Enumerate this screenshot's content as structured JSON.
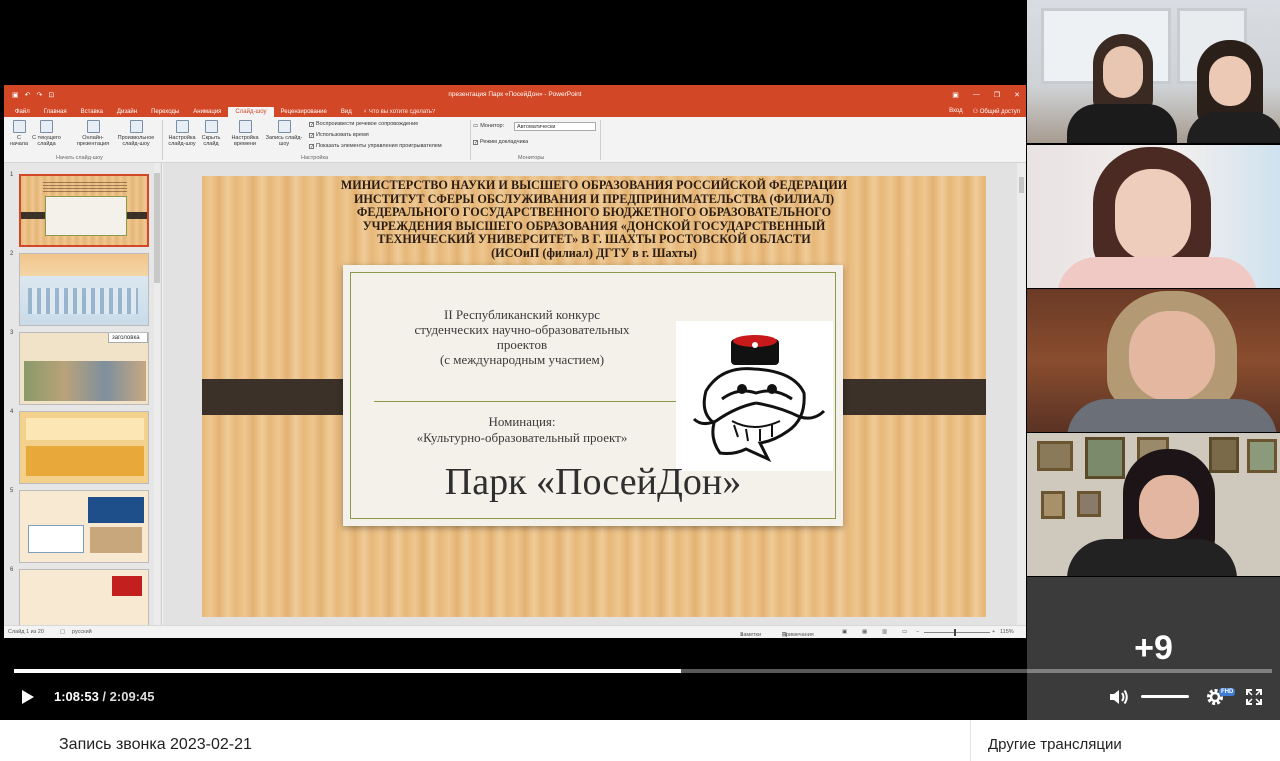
{
  "player": {
    "current_time": "1:08:53",
    "separator": " / ",
    "duration": "2:09:45",
    "progress": 0.53,
    "extra_participants": "+9",
    "quality_badge": "FHD"
  },
  "powerpoint": {
    "window_title": "презентация Парк «ПосейДон» - PowerPoint",
    "window_controls": [
      "▣",
      "—",
      "❐",
      "✕"
    ],
    "tabs": [
      "Файл",
      "Главная",
      "Вставка",
      "Дизайн",
      "Переходы",
      "Анимация",
      "Слайд-шоу",
      "Рецензирование",
      "Вид"
    ],
    "active_tab": "Слайд-шоу",
    "tell_me": "Что вы хотите сделать?",
    "sign_in": "Вход",
    "share": "Общий доступ",
    "ribbon": {
      "btn_from_start": "С начала",
      "btn_from_current": "С текущего слайда",
      "btn_online": "Онлайн-презентация",
      "btn_custom": "Произвольное слайд-шоу",
      "group_start": "Начать слайд-шоу",
      "btn_setup": "Настройка слайд-шоу",
      "btn_hide": "Скрыть слайд",
      "btn_timings": "Настройка времени",
      "btn_record": "Запись слайд-шоу",
      "chk_narration": "Воспроизвести речевое сопровождение",
      "chk_timings": "Использовать время",
      "chk_media": "Показать элементы управления проигрывателем",
      "group_setup": "Настройка",
      "monitor_label": "Монитор:",
      "monitor_value": "Автоматически",
      "chk_presenter": "Режим докладчика",
      "group_monitors": "Мониторы"
    },
    "thumbnails": [
      "1",
      "2",
      "3",
      "4",
      "5",
      "6"
    ],
    "thumb_tooltip": "Без заголовка",
    "status": {
      "slide": "Слайд 1 из 20",
      "language": "русский",
      "notes": "Заметки",
      "comments": "Примечания",
      "zoom": "115%"
    },
    "slide": {
      "header_lines": [
        "МИНИСТЕРСТВО НАУКИ И ВЫСШЕГО ОБРАЗОВАНИЯ РОССИЙСКОЙ ФЕДЕРАЦИИ",
        "ИНСТИТУТ СФЕРЫ ОБСЛУЖИВАНИЯ И ПРЕДПРИНИМАТЕЛЬСТВА (ФИЛИАЛ)",
        "ФЕДЕРАЛЬНОГО ГОСУДАРСТВЕННОГО БЮДЖЕТНОГО ОБРАЗОВАТЕЛЬНОГО",
        "УЧРЕЖДЕНИЯ ВЫСШЕГО ОБРАЗОВАНИЯ «ДОНСКОЙ ГОСУДАРСТВЕННЫЙ",
        "ТЕХНИЧЕСКИЙ УНИВЕРСИТЕТ» В Г. ШАХТЫ РОСТОВСКОЙ ОБЛАСТИ",
        "(ИСОиП (филиал) ДГТУ в г. Шахты)"
      ],
      "contest_lines": [
        "II Республиканский конкурс",
        "студенческих научно-образовательных",
        "проектов",
        "(с международным участием)"
      ],
      "nomination_lines": [
        "Номинация:",
        "«Культурно-образовательный проект»"
      ],
      "title": "Парк «ПосейДон»"
    }
  },
  "page": {
    "recording_title": "Запись звонка 2023-02-21",
    "other_streams": "Другие трансляции"
  }
}
